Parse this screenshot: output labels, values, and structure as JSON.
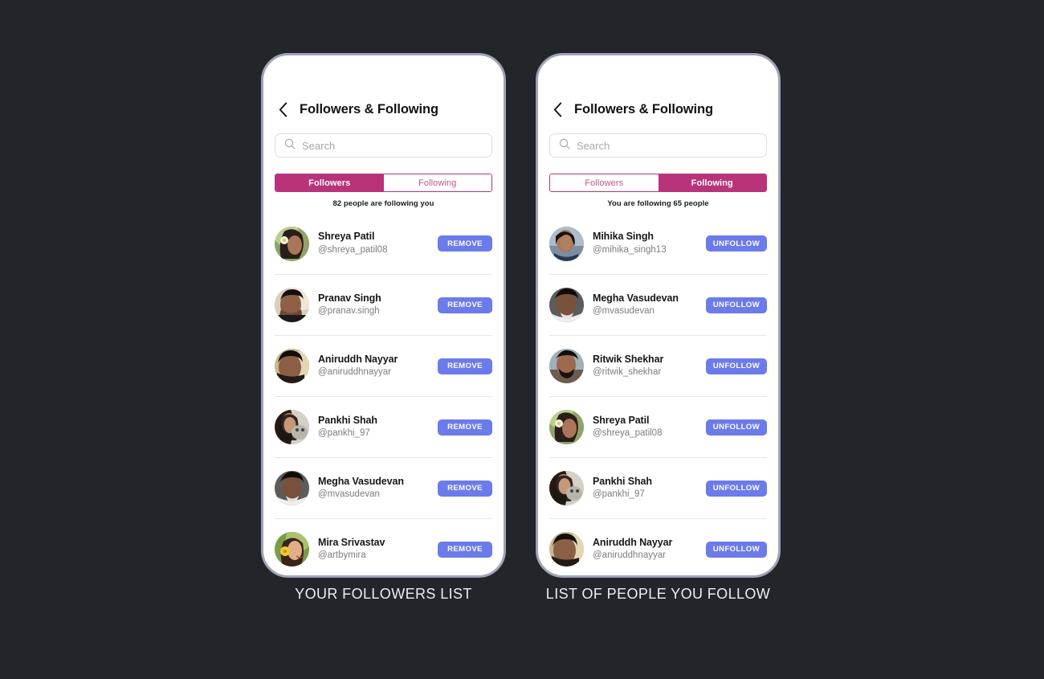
{
  "background_color": "#222529",
  "accent_color": "#b8337a",
  "action_button_color": "#6b7bea",
  "phones": [
    {
      "caption": "YOUR FOLLOWERS LIST",
      "header": {
        "title": "Followers & Following",
        "back_icon": "chevron-left-icon"
      },
      "search": {
        "placeholder": "Search",
        "value": "",
        "icon": "search-icon"
      },
      "tabs": [
        {
          "label": "Followers",
          "active": true
        },
        {
          "label": "Following",
          "active": false
        }
      ],
      "count_text": "82 people are following you",
      "action_label": "REMOVE",
      "users": [
        {
          "name": "Shreya Patil",
          "handle": "@shreya_patil08"
        },
        {
          "name": "Pranav Singh",
          "handle": "@pranav.singh"
        },
        {
          "name": "Aniruddh Nayyar",
          "handle": "@aniruddhnayyar"
        },
        {
          "name": "Pankhi Shah",
          "handle": "@pankhi_97"
        },
        {
          "name": "Megha Vasudevan",
          "handle": "@mvasudevan"
        },
        {
          "name": "Mira Srivastav",
          "handle": "@artbymira"
        }
      ]
    },
    {
      "caption": "LIST OF PEOPLE YOU FOLLOW",
      "header": {
        "title": "Followers & Following",
        "back_icon": "chevron-left-icon"
      },
      "search": {
        "placeholder": "Search",
        "value": "",
        "icon": "search-icon"
      },
      "tabs": [
        {
          "label": "Followers",
          "active": false
        },
        {
          "label": "Following",
          "active": true
        }
      ],
      "count_text": "You are following 65 people",
      "action_label": "UNFOLLOW",
      "users": [
        {
          "name": "Mihika Singh",
          "handle": "@mihika_singh13"
        },
        {
          "name": "Megha Vasudevan",
          "handle": "@mvasudevan"
        },
        {
          "name": "Ritwik Shekhar",
          "handle": "@ritwik_shekhar"
        },
        {
          "name": "Shreya Patil",
          "handle": "@shreya_patil08"
        },
        {
          "name": "Pankhi Shah",
          "handle": "@pankhi_97"
        },
        {
          "name": "Aniruddh Nayyar",
          "handle": "@aniruddhnayyar"
        }
      ]
    }
  ]
}
